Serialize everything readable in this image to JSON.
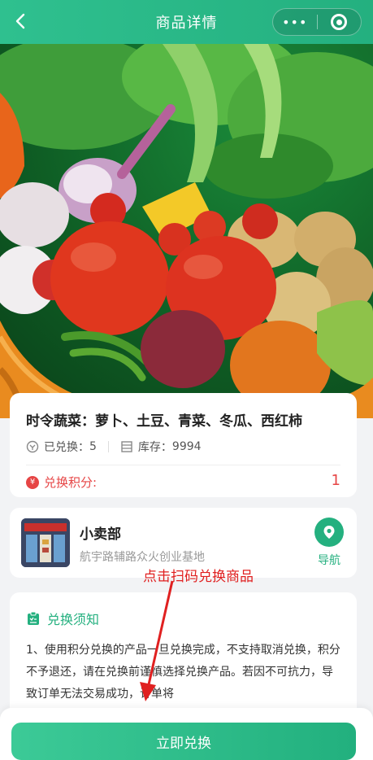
{
  "navbar": {
    "title": "商品详情"
  },
  "product": {
    "title": "时令蔬菜：萝卜、土豆、青菜、冬瓜、西红柿",
    "exchanged_label": "已兑换：",
    "exchanged_value": "5",
    "stock_label": "库存：",
    "stock_value": "9994",
    "points_label": "兑换积分:",
    "points_value": "1"
  },
  "store": {
    "name": "小卖部",
    "address": "航宇路辅路众火创业基地",
    "nav_label": "导航"
  },
  "annotation": "点击扫码兑换商品",
  "notice": {
    "title": "兑换须知",
    "body": "1、使用积分兑换的产品一旦兑换完成，不支持取消兑换，积分不予退还，请在兑换前谨慎选择兑换产品。若因不可抗力，导致订单无法交易成功，订单将"
  },
  "bottom": {
    "button_label": "立即兑换"
  },
  "colors": {
    "brand_green": "#24b07f",
    "points_red": "#e64545",
    "annotation_red": "#e02020"
  }
}
